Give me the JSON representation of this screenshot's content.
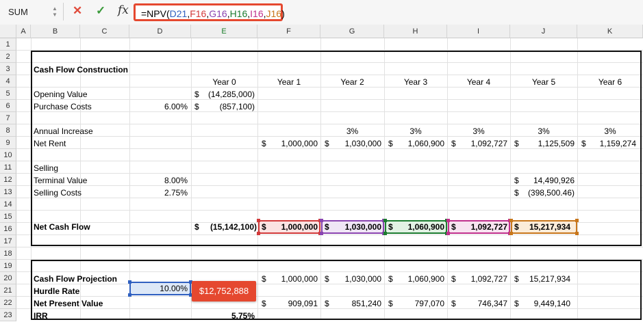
{
  "formula_bar": {
    "name_box": "SUM",
    "formula": {
      "prefix": "=NPV(",
      "args": [
        {
          "text": "D21",
          "color": "#3060c0"
        },
        {
          "text": "F16",
          "color": "#d23a3a"
        },
        {
          "text": "G16",
          "color": "#8a44b0"
        },
        {
          "text": "H16",
          "color": "#1c7c30"
        },
        {
          "text": "I16",
          "color": "#c0308c"
        },
        {
          "text": "J16",
          "color": "#c8761b"
        }
      ],
      "separator": ",",
      "suffix": ")"
    }
  },
  "columns": [
    "A",
    "B",
    "C",
    "D",
    "E",
    "F",
    "G",
    "H",
    "I",
    "J",
    "K"
  ],
  "rows": [
    "1",
    "2",
    "3",
    "4",
    "5",
    "6",
    "7",
    "8",
    "9",
    "10",
    "11",
    "12",
    "13",
    "14",
    "15",
    "16",
    "17",
    "18",
    "19",
    "20",
    "21",
    "22",
    "23"
  ],
  "sheet": {
    "title": "Cash Flow Construction",
    "years": [
      "Year 0",
      "Year 1",
      "Year 2",
      "Year 3",
      "Year 4",
      "Year 5",
      "Year 6"
    ],
    "opening_value": {
      "label": "Opening Value",
      "cur": "$",
      "value": "(14,285,000)"
    },
    "purchase_costs": {
      "label": "Purchase Costs",
      "rate": "6.00%",
      "cur": "$",
      "value": "(857,100)"
    },
    "annual_increase": {
      "label": "Annual Increase",
      "values": [
        "3%",
        "3%",
        "3%",
        "3%",
        "3%"
      ]
    },
    "net_rent": {
      "label": "Net Rent",
      "cur": "$",
      "values": [
        "1,000,000",
        "1,030,000",
        "1,060,900",
        "1,092,727",
        "1,125,509",
        "1,159,274"
      ]
    },
    "selling": {
      "label": "Selling"
    },
    "terminal_value": {
      "label": "Terminal Value",
      "rate": "8.00%",
      "cur": "$",
      "value": "14,490,926"
    },
    "selling_costs": {
      "label": "Selling Costs",
      "rate": "2.75%",
      "cur": "$",
      "value": "(398,500.46)"
    },
    "net_cash_flow": {
      "label": "Net Cash Flow",
      "cur": "$",
      "values": [
        "(15,142,100)",
        "1,000,000",
        "1,030,000",
        "1,060,900",
        "1,092,727",
        "15,217,934"
      ]
    },
    "projection": {
      "title": "Cash Flow Projection",
      "cur": "$",
      "values": [
        "1,000,000",
        "1,030,000",
        "1,060,900",
        "1,092,727",
        "15,217,934"
      ]
    },
    "hurdle_rate": {
      "label": "Hurdle Rate",
      "value": "10.00%"
    },
    "npv": {
      "label": "Net Present Value",
      "cur": "$",
      "values": [
        "909,091",
        "851,240",
        "797,070",
        "746,347",
        "9,449,140"
      ]
    },
    "irr": {
      "label": "IRR",
      "value": "5.75%"
    },
    "tooltip": "$12,752,888"
  },
  "colors": {
    "accent_red": "#e5482f",
    "f16": "#d23a3a",
    "g16": "#8a44b0",
    "h16": "#1c7c30",
    "i16": "#c0308c",
    "j16": "#c8761b",
    "d21": "#3060c0"
  }
}
